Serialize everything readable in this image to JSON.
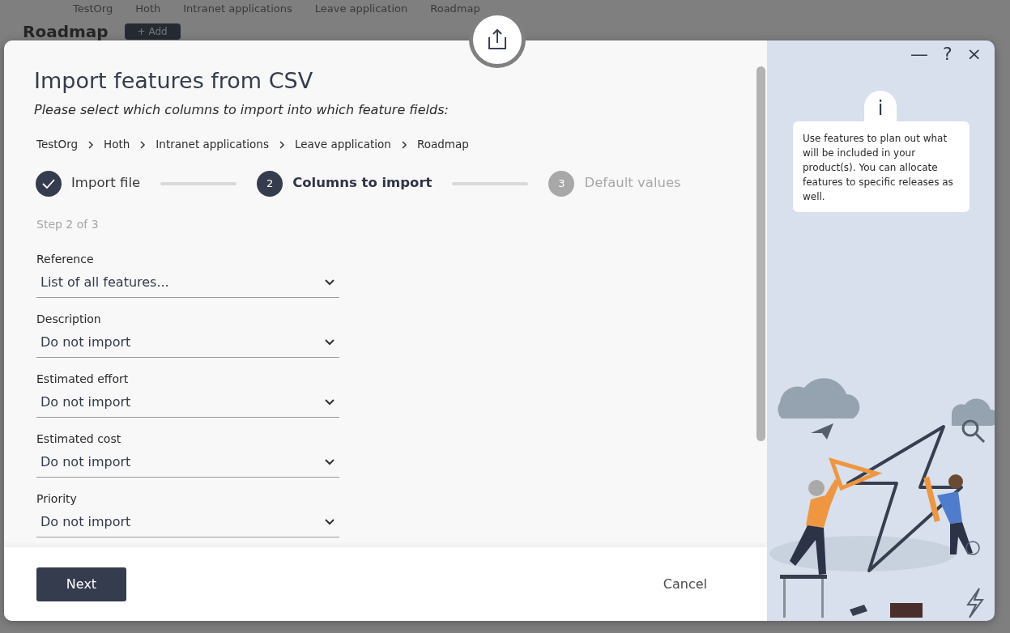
{
  "background": {
    "breadcrumb": [
      "TestOrg",
      "Hoth",
      "Intranet applications",
      "Leave application",
      "Roadmap"
    ],
    "page_title": "Roadmap",
    "add_button": "+ Add"
  },
  "dialog": {
    "title": "Import features from CSV",
    "subtitle": "Please select which columns to import into which feature fields:",
    "breadcrumb": [
      "TestOrg",
      "Hoth",
      "Intranet applications",
      "Leave application",
      "Roadmap"
    ],
    "steps": [
      {
        "label": "Import file",
        "kind": "done"
      },
      {
        "number": "2",
        "label": "Columns to import",
        "kind": "current"
      },
      {
        "number": "3",
        "label": "Default values",
        "kind": "pending"
      }
    ],
    "step_note": "Step 2 of 3",
    "fields": [
      {
        "label": "Reference",
        "value": "List of all features..."
      },
      {
        "label": "Description",
        "value": "Do not import"
      },
      {
        "label": "Estimated effort",
        "value": "Do not import"
      },
      {
        "label": "Estimated cost",
        "value": "Do not import"
      },
      {
        "label": "Priority",
        "value": "Do not import"
      }
    ],
    "buttons": {
      "primary": "Next",
      "secondary": "Cancel"
    },
    "window_controls": [
      "—",
      "?",
      "×"
    ],
    "info": {
      "icon": "i",
      "text": "Use features to plan out what will be included in your product(s). You can allocate features to specific releases as well."
    }
  }
}
